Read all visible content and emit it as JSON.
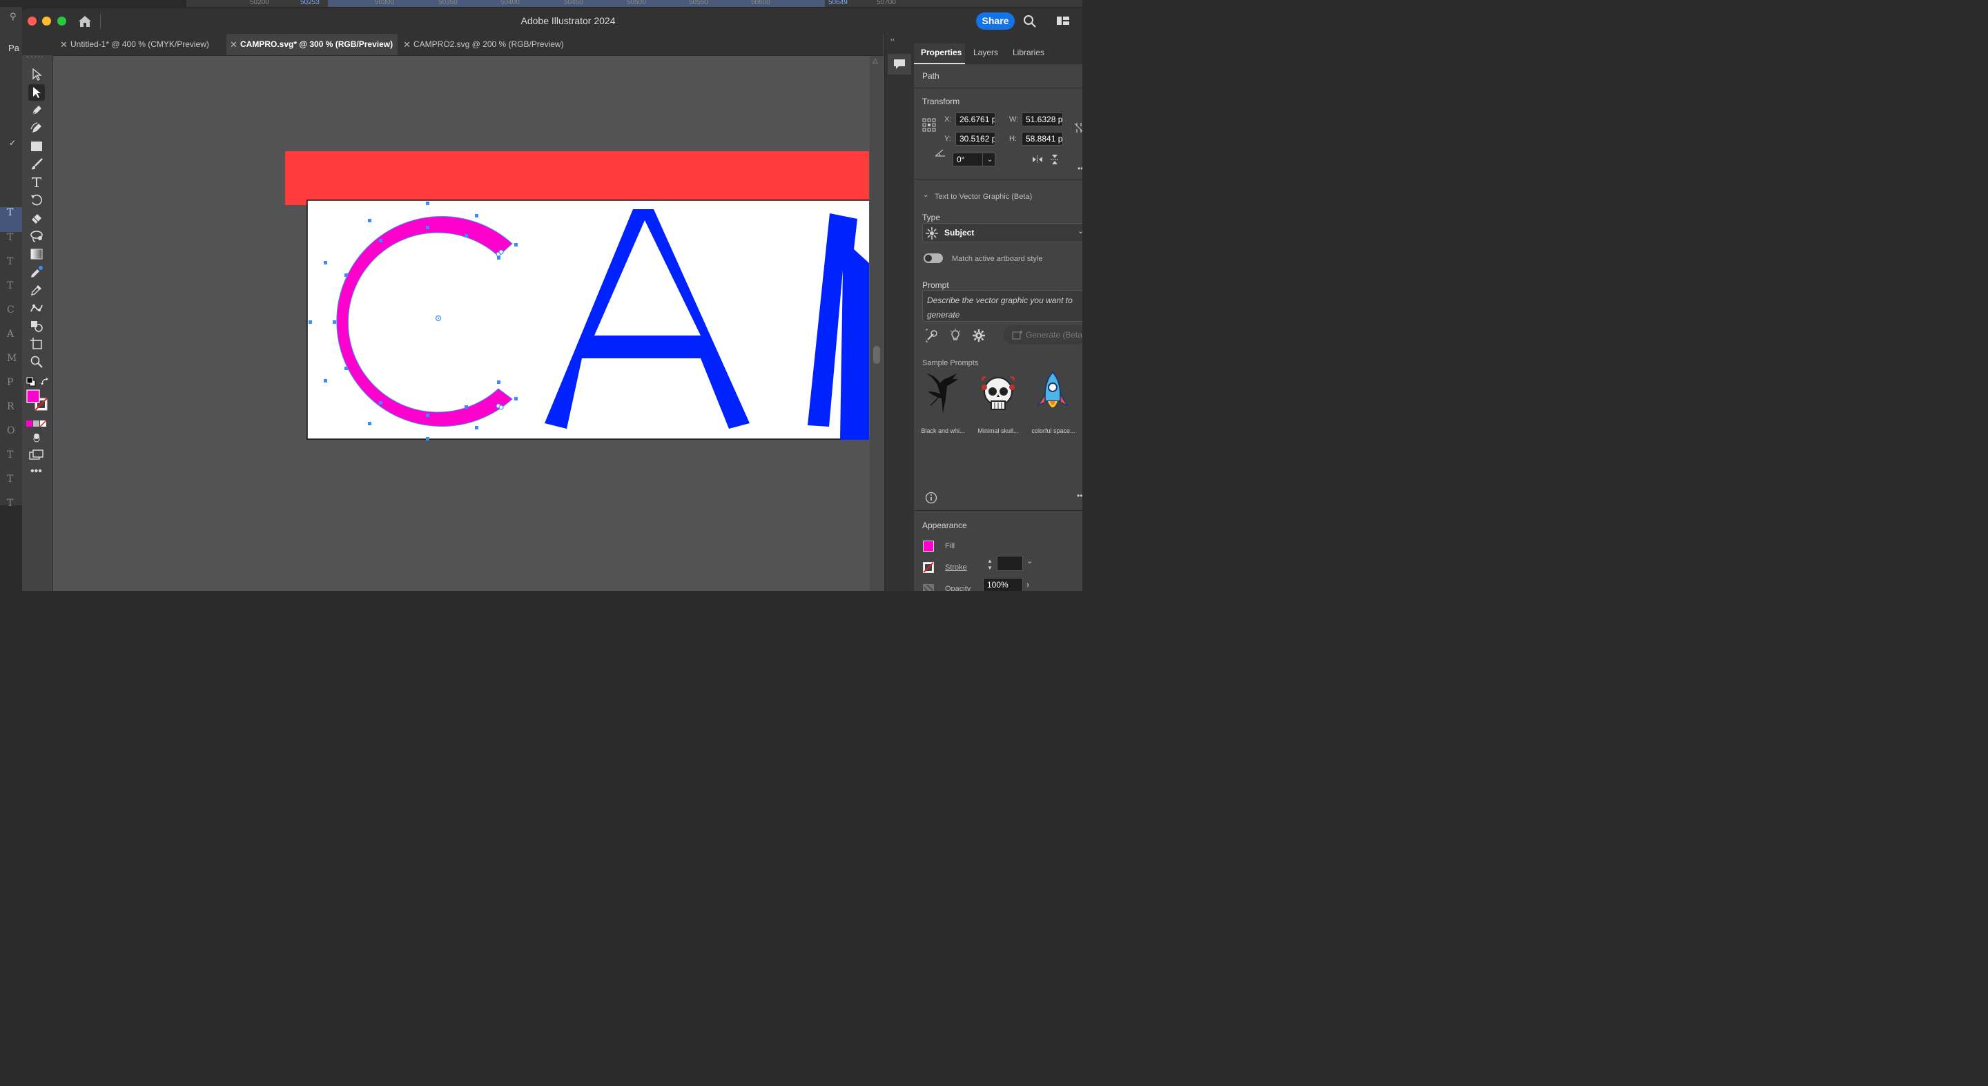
{
  "window": {
    "title": "Adobe Illustrator 2024",
    "share_label": "Share"
  },
  "background_app": {
    "ruler_ticks": [
      "50200",
      "50253",
      "50300",
      "50350",
      "50400",
      "50450",
      "50500",
      "50550",
      "50600",
      "50649",
      "50700"
    ],
    "left_letters": [
      "T",
      "T",
      "T",
      "T",
      "C",
      "A",
      "M",
      "P",
      "R",
      "O",
      "T",
      "T",
      "T"
    ],
    "page_label": "Pa"
  },
  "tabs": [
    {
      "label": "Untitled-1* @ 400 % (CMYK/Preview)",
      "active": false
    },
    {
      "label": "CAMPRO.svg* @ 300 % (RGB/Preview)",
      "active": true
    },
    {
      "label": "CAMPRO2.svg @ 200 % (RGB/Preview)",
      "active": false
    }
  ],
  "tools": [
    "selection-tool",
    "direct-selection-tool",
    "pen-tool",
    "curvature-tool",
    "rectangle-tool",
    "paintbrush-tool",
    "type-tool",
    "rotate-tool",
    "eraser-tool",
    "lasso-tool",
    "gradient-tool",
    "eyedropper-color-tool",
    "eyedropper-tool",
    "puppet-warp-tool",
    "shape-builder-tool",
    "artboard-tool",
    "zoom-tool"
  ],
  "colors": {
    "fill": "#ff00cc",
    "letter_c": "#ff00cc",
    "letters_am": "#0022ff",
    "red_bar": "#ff3b3b",
    "accent": "#1473e6",
    "anchor": "#3d8bff"
  },
  "artwork": {
    "letters": "CAM"
  },
  "properties": {
    "tabs": [
      "Properties",
      "Layers",
      "Libraries"
    ],
    "object_type": "Path",
    "transform": {
      "title": "Transform",
      "x_label": "X:",
      "x": "26.6761 p",
      "y_label": "Y:",
      "y": "30.5162 p",
      "w_label": "W:",
      "w": "51.6328 p",
      "h_label": "H:",
      "h": "58.8841 p",
      "angle": "0°"
    },
    "t2v": {
      "title": "Text to Vector Graphic (Beta)",
      "type_label": "Type",
      "type_value": "Subject",
      "match_label": "Match active artboard style",
      "prompt_label": "Prompt",
      "prompt_placeholder": "Describe the vector graphic you want to generate",
      "generate_label": "Generate (Beta)",
      "samples_label": "Sample Prompts",
      "samples": [
        "Black and whi...",
        "Minimal skull...",
        "colorful space..."
      ]
    },
    "appearance": {
      "title": "Appearance",
      "fill_label": "Fill",
      "stroke_label": "Stroke",
      "opacity_label": "Opacity",
      "opacity_value": "100%"
    }
  }
}
